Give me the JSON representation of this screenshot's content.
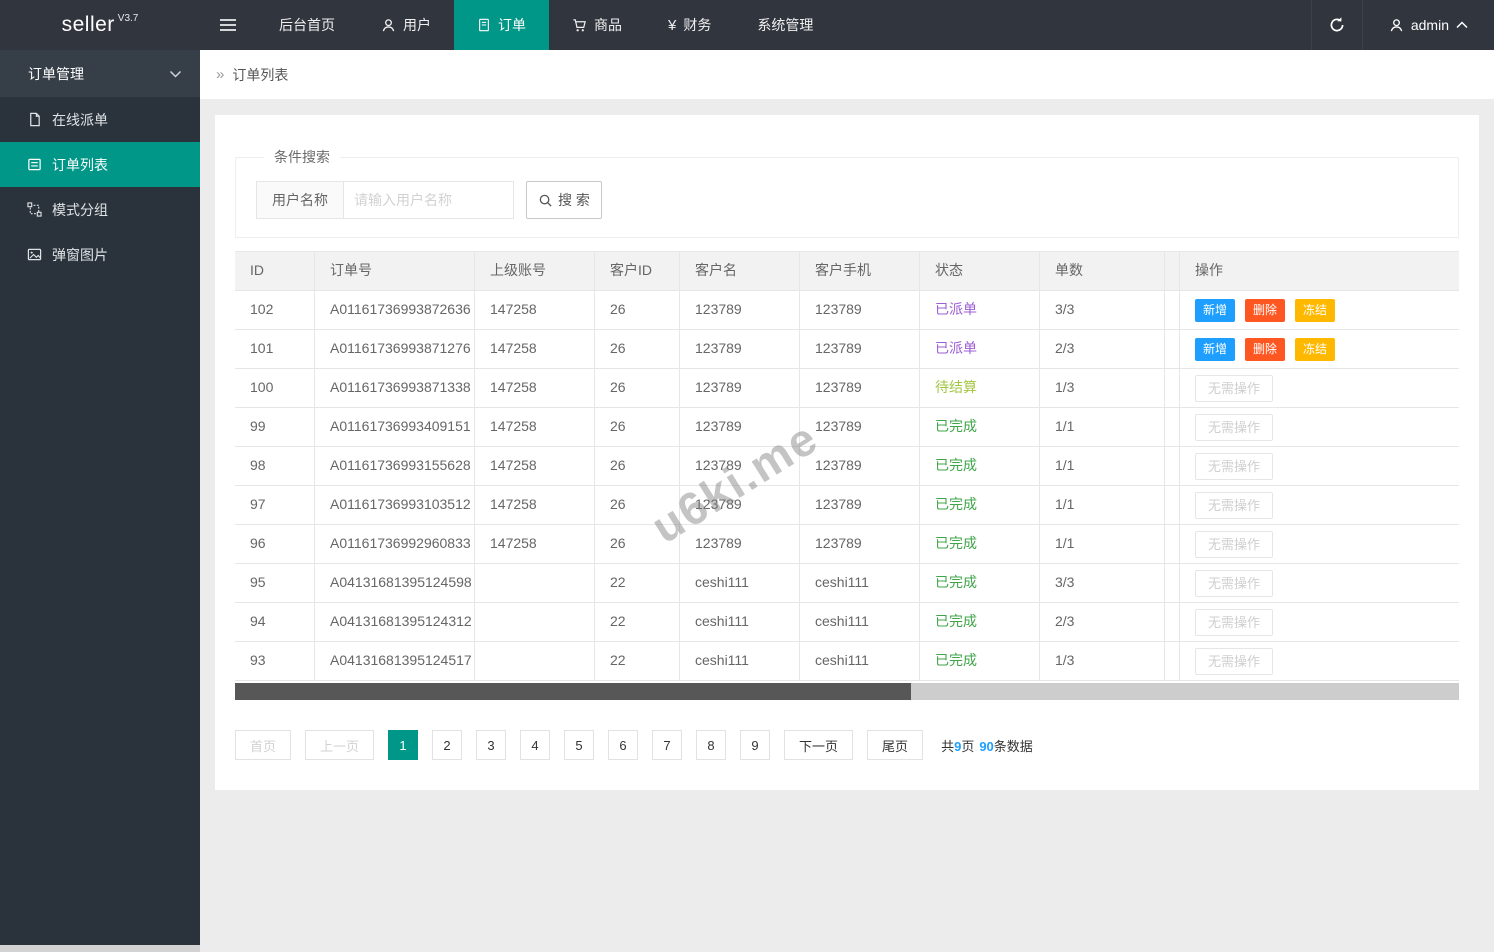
{
  "navbar": {
    "logo": "seller",
    "version": "V3.7",
    "items": [
      {
        "label": "后台首页",
        "icon": "none"
      },
      {
        "label": "用户",
        "icon": "user-icon"
      },
      {
        "label": "订单",
        "icon": "document-icon"
      },
      {
        "label": "商品",
        "icon": "cart-icon"
      },
      {
        "label": "财务",
        "icon": "yen-icon",
        "glyph": "¥"
      },
      {
        "label": "系统管理",
        "icon": "none"
      }
    ],
    "username": "admin"
  },
  "sidebar": {
    "group_label": "订单管理",
    "items": [
      {
        "label": "在线派单",
        "icon": "page-icon"
      },
      {
        "label": "订单列表",
        "icon": "list-icon"
      },
      {
        "label": "模式分组",
        "icon": "group-icon"
      },
      {
        "label": "弹窗图片",
        "icon": "image-icon"
      }
    ]
  },
  "breadcrumb": {
    "arrow": "»",
    "label": "订单列表"
  },
  "search": {
    "legend": "条件搜索",
    "field_label": "用户名称",
    "placeholder": "请输入用户名称",
    "button_label": "搜 索"
  },
  "table": {
    "headers": [
      "ID",
      "订单号",
      "上级账号",
      "客户ID",
      "客户名",
      "客户手机",
      "状态",
      "单数",
      "操作"
    ],
    "action_buttons": [
      {
        "label": "新增",
        "name": "add-button",
        "color": "#1E9FFF"
      },
      {
        "label": "删除",
        "name": "delete-button",
        "color": "#FF5722"
      },
      {
        "label": "冻结",
        "name": "freeze-button",
        "color": "#FFB800"
      }
    ],
    "no_action_label": "无需操作",
    "status_colors": {
      "dispatched": "#9d5fd3",
      "pending": "#a3c643",
      "completed": "#3FA548"
    },
    "rows": [
      {
        "id": "102",
        "order_no": "A01161736993872636",
        "parent_account": "147258",
        "customer_id": "26",
        "customer_name": "123789",
        "customer_phone": "123789",
        "status": "已派单",
        "status_color": "#9d5fd3",
        "count": "3/3",
        "has_actions": true
      },
      {
        "id": "101",
        "order_no": "A01161736993871276",
        "parent_account": "147258",
        "customer_id": "26",
        "customer_name": "123789",
        "customer_phone": "123789",
        "status": "已派单",
        "status_color": "#9d5fd3",
        "count": "2/3",
        "has_actions": true
      },
      {
        "id": "100",
        "order_no": "A01161736993871338",
        "parent_account": "147258",
        "customer_id": "26",
        "customer_name": "123789",
        "customer_phone": "123789",
        "status": "待结算",
        "status_color": "#a3c643",
        "count": "1/3",
        "has_actions": false
      },
      {
        "id": "99",
        "order_no": "A01161736993409151",
        "parent_account": "147258",
        "customer_id": "26",
        "customer_name": "123789",
        "customer_phone": "123789",
        "status": "已完成",
        "status_color": "#3FA548",
        "count": "1/1",
        "has_actions": false
      },
      {
        "id": "98",
        "order_no": "A01161736993155628",
        "parent_account": "147258",
        "customer_id": "26",
        "customer_name": "123789",
        "customer_phone": "123789",
        "status": "已完成",
        "status_color": "#3FA548",
        "count": "1/1",
        "has_actions": false
      },
      {
        "id": "97",
        "order_no": "A01161736993103512",
        "parent_account": "147258",
        "customer_id": "26",
        "customer_name": "123789",
        "customer_phone": "123789",
        "status": "已完成",
        "status_color": "#3FA548",
        "count": "1/1",
        "has_actions": false
      },
      {
        "id": "96",
        "order_no": "A01161736992960833",
        "parent_account": "147258",
        "customer_id": "26",
        "customer_name": "123789",
        "customer_phone": "123789",
        "status": "已完成",
        "status_color": "#3FA548",
        "count": "1/1",
        "has_actions": false
      },
      {
        "id": "95",
        "order_no": "A04131681395124598",
        "parent_account": "",
        "customer_id": "22",
        "customer_name": "ceshi111",
        "customer_phone": "ceshi111",
        "status": "已完成",
        "status_color": "#3FA548",
        "count": "3/3",
        "has_actions": false
      },
      {
        "id": "94",
        "order_no": "A04131681395124312",
        "parent_account": "",
        "customer_id": "22",
        "customer_name": "ceshi111",
        "customer_phone": "ceshi111",
        "status": "已完成",
        "status_color": "#3FA548",
        "count": "2/3",
        "has_actions": false
      },
      {
        "id": "93",
        "order_no": "A04131681395124517",
        "parent_account": "",
        "customer_id": "22",
        "customer_name": "ceshi111",
        "customer_phone": "ceshi111",
        "status": "已完成",
        "status_color": "#3FA548",
        "count": "1/3",
        "has_actions": false
      }
    ]
  },
  "pagination": {
    "items": [
      {
        "label": "首页",
        "name": "first-page-button",
        "state": "disabled",
        "wide": true
      },
      {
        "label": "上一页",
        "name": "prev-page-button",
        "state": "disabled",
        "wide": true
      },
      {
        "label": "1",
        "name": "page-button-1",
        "state": "active"
      },
      {
        "label": "2",
        "name": "page-button-2",
        "state": "normal"
      },
      {
        "label": "3",
        "name": "page-button-3",
        "state": "normal"
      },
      {
        "label": "4",
        "name": "page-button-4",
        "state": "normal"
      },
      {
        "label": "5",
        "name": "page-button-5",
        "state": "normal"
      },
      {
        "label": "6",
        "name": "page-button-6",
        "state": "normal"
      },
      {
        "label": "7",
        "name": "page-button-7",
        "state": "normal"
      },
      {
        "label": "8",
        "name": "page-button-8",
        "state": "normal"
      },
      {
        "label": "9",
        "name": "page-button-9",
        "state": "normal"
      },
      {
        "label": "下一页",
        "name": "next-page-button",
        "state": "normal",
        "wide": true
      },
      {
        "label": "尾页",
        "name": "last-page-button",
        "state": "normal",
        "wide": true
      }
    ],
    "summary": {
      "part1": "共",
      "pages": "9",
      "part2": "页",
      "count": "90",
      "part3": "条数据"
    }
  },
  "watermark": {
    "text": "u6ki.me"
  },
  "colors": {
    "accent": "#009688",
    "navbar_bg": "#31353e",
    "sidebar_bg": "#2a333b",
    "link_blue": "#1E9FFF"
  }
}
